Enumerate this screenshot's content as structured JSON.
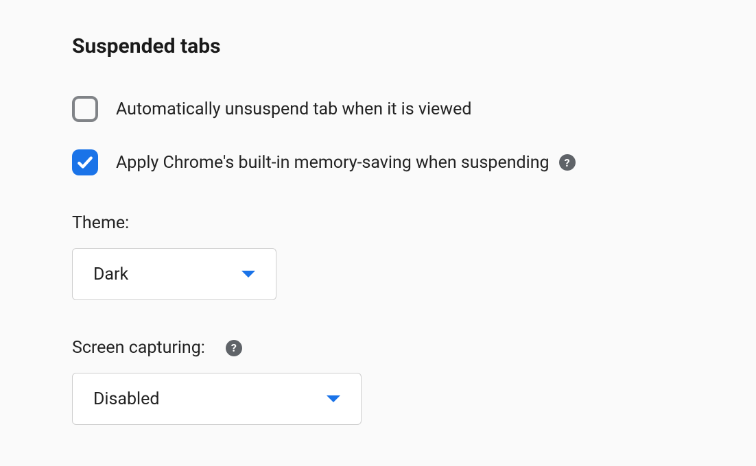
{
  "section": {
    "title": "Suspended tabs"
  },
  "options": {
    "autoUnsuspend": {
      "label": "Automatically unsuspend tab when it is viewed",
      "checked": false
    },
    "memorySaving": {
      "label": "Apply Chrome's built-in memory-saving when suspending",
      "checked": true
    }
  },
  "theme": {
    "label": "Theme:",
    "selected": "Dark"
  },
  "screenCapturing": {
    "label": "Screen capturing:",
    "selected": "Disabled"
  }
}
